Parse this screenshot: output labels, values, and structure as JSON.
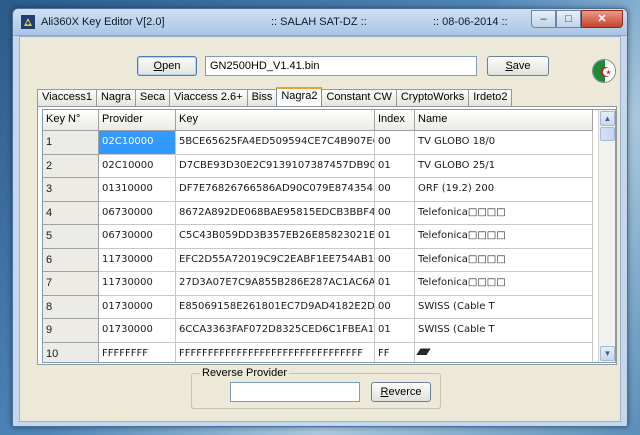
{
  "window": {
    "title_left": "Ali360X Key Editor V[2.0]",
    "title_center": ":: SALAH SAT-DZ ::",
    "title_right": ":: 08-06-2014 ::",
    "minimize": "–",
    "maximize": "□",
    "close": "✕"
  },
  "toolbar": {
    "open_prefix": "",
    "open_hotkey": "O",
    "open_suffix": "pen",
    "file_path": "GN2500HD_V1.41.bin",
    "save_prefix": "",
    "save_hotkey": "S",
    "save_suffix": "ave"
  },
  "tabs": [
    "Viaccess1",
    "Nagra",
    "Seca",
    "Viaccess 2.6+",
    "Biss",
    "Nagra2",
    "Constant CW",
    "CryptoWorks",
    "Irdeto2"
  ],
  "active_tab": "Nagra2",
  "grid": {
    "columns": [
      "Key N°",
      "Provider",
      "Key",
      "Index",
      "Name"
    ],
    "rows": [
      {
        "n": "1",
        "provider": "02C10000",
        "key": "5BCE65625FA4ED509594CE7C4B907EC8",
        "index": "00",
        "name": "TV GLOBO  18/0"
      },
      {
        "n": "2",
        "provider": "02C10000",
        "key": "D7CBE93D30E2C9139107387457DB9023",
        "index": "01",
        "name": "TV GLOBO  25/1"
      },
      {
        "n": "3",
        "provider": "01310000",
        "key": "DF7E76826766586AD90C079E87435437",
        "index": "00",
        "name": "ORF (19.2) 200"
      },
      {
        "n": "4",
        "provider": "06730000",
        "key": "8672A892DE068BAE95815EDCB3BBF4C5",
        "index": "00",
        "name": "Telefonica□□□□"
      },
      {
        "n": "5",
        "provider": "06730000",
        "key": "C5C43B059DD3B357EB26E85823021E43",
        "index": "01",
        "name": "Telefonica□□□□"
      },
      {
        "n": "6",
        "provider": "11730000",
        "key": "EFC2D55A72019C9C2EABF1EE754AB134",
        "index": "00",
        "name": "Telefonica□□□□"
      },
      {
        "n": "7",
        "provider": "11730000",
        "key": "27D3A07E7C9A855B286E287AC1AC6AC0",
        "index": "01",
        "name": "Telefonica□□□□"
      },
      {
        "n": "8",
        "provider": "01730000",
        "key": "E85069158E261801EC7D9AD4182E2D21",
        "index": "00",
        "name": "SWISS (Cable T"
      },
      {
        "n": "9",
        "provider": "01730000",
        "key": "6CCA3363FAF072D8325CED6C1FBEA126",
        "index": "01",
        "name": "SWISS (Cable T"
      },
      {
        "n": "10",
        "provider": "FFFFFFFF",
        "key": "FFFFFFFFFFFFFFFFFFFFFFFFFFFFFFFF",
        "index": "FF",
        "name": "⁄⁄⁄⁄⁄⁄⁄⁄⁄⁄⁄⁄⁄⁄⁄⁄⁄⁄⁄⁄"
      }
    ]
  },
  "reverse": {
    "group_label": "Reverse Provider",
    "input_value": "",
    "btn_prefix": "",
    "btn_hotkey": "R",
    "btn_suffix": "everce"
  },
  "colors": {
    "selection": "#3399ff",
    "flag_green": "#1a8c3a",
    "flag_red": "#d21f26"
  }
}
